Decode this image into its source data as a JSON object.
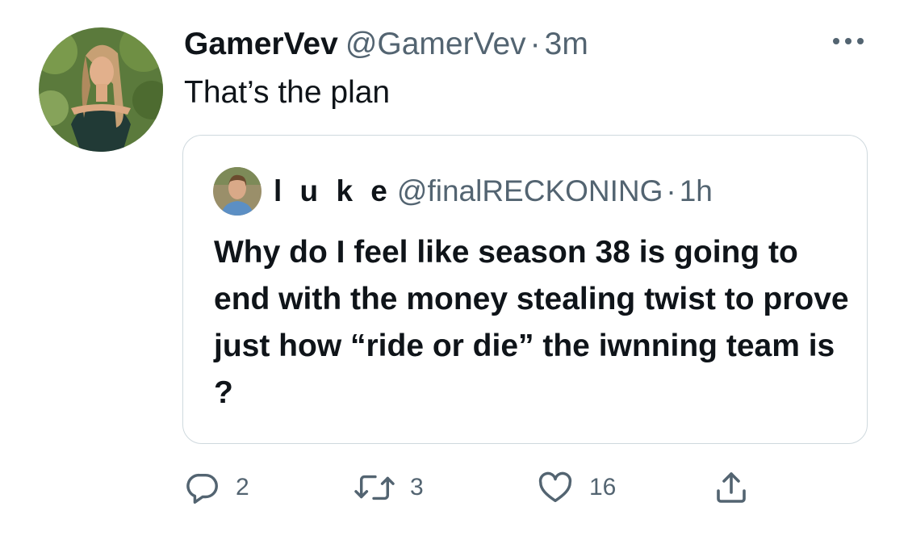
{
  "tweet": {
    "author": {
      "display_name": "GamerVev",
      "handle": "@GamerVev",
      "separator": "·",
      "time": "3m"
    },
    "text": "That’s the plan",
    "more_icon": "more-horizontal-icon"
  },
  "quote": {
    "author": {
      "display_name": "l u k e",
      "handle": "@finalRECKONING",
      "separator": "·",
      "time": "1h"
    },
    "text": "Why do I feel like season 38 is going to end with the money stealing twist to prove just how “ride or die” the iwnning team is ?"
  },
  "actions": {
    "reply": {
      "icon": "reply-icon",
      "count": "2"
    },
    "retweet": {
      "icon": "retweet-icon",
      "count": "3"
    },
    "like": {
      "icon": "heart-icon",
      "count": "16"
    },
    "share": {
      "icon": "share-icon"
    }
  },
  "colors": {
    "text_primary": "#0f1419",
    "text_secondary": "#536471",
    "border": "#cfd9de"
  }
}
